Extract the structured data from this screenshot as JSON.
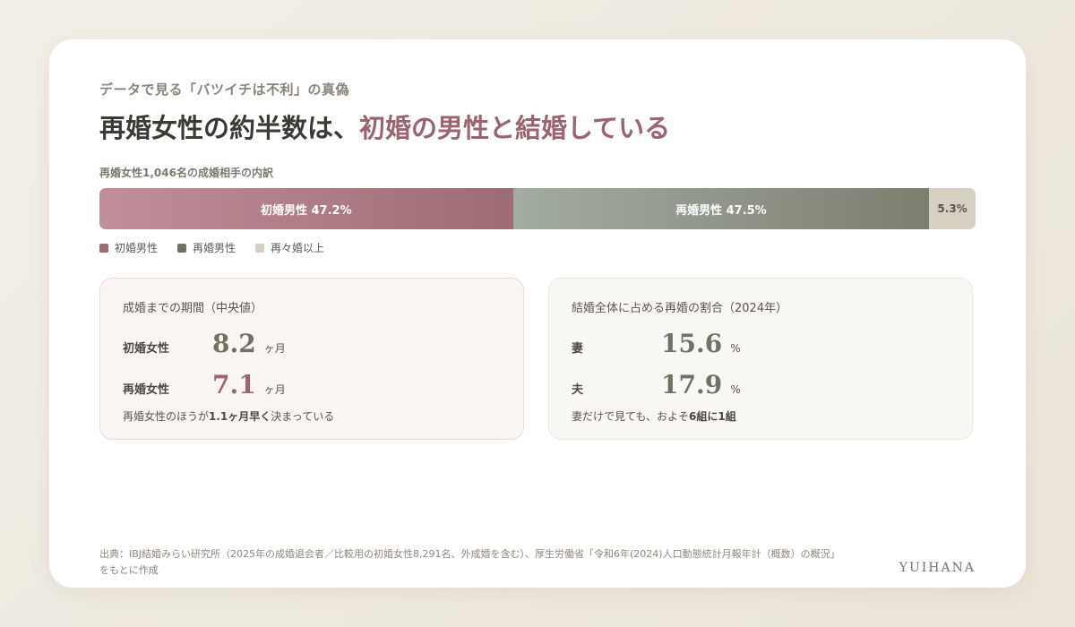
{
  "header": {
    "eyebrow": "データで見る「バツイチは不利」の真偽",
    "headline_main": "再婚女性の約半数は、",
    "headline_accent": "初婚の男性と結婚している"
  },
  "bar": {
    "caption": "再婚女性1,046名の成婚相手の内訳",
    "segments": [
      {
        "label": "初婚男性 47.2%",
        "value": 47.2,
        "color": "#9d6b74"
      },
      {
        "label": "再婚男性 47.5%",
        "value": 47.5,
        "color": "#7c7f70"
      },
      {
        "label": "5.3%",
        "value": 5.3,
        "color": "#d6d0c3"
      }
    ],
    "legend": [
      {
        "label": "初婚男性",
        "color": "#9d6b74"
      },
      {
        "label": "再婚男性",
        "color": "#6f7262"
      },
      {
        "label": "再々婚以上",
        "color": "#d6d0c3"
      }
    ]
  },
  "left_box": {
    "title": "成婚までの期間（中央値）",
    "rows": [
      {
        "label": "初婚女性",
        "value": "8.2",
        "unit": "ヶ月"
      },
      {
        "label": "再婚女性",
        "value": "7.1",
        "unit": "ヶ月"
      }
    ],
    "note_pre": "再婚女性のほうが",
    "note_bold": "1.1ヶ月早く",
    "note_post": "決まっている"
  },
  "right_box": {
    "title": "結婚全体に占める再婚の割合（2024年）",
    "rows": [
      {
        "label": "妻",
        "value": "15.6",
        "unit": "%"
      },
      {
        "label": "夫",
        "value": "17.9",
        "unit": "%"
      }
    ],
    "note_pre": "妻だけで見ても、およそ",
    "note_bold": "6組に1組",
    "note_post": ""
  },
  "footer": {
    "source_line1": "出典：IBJ結婚みらい研究所（2025年の成婚退会者／比較用の初婚女性8,291名、外成婚を含む）、厚生労働省「令和6年(2024)人口動態統計月報年計（概数）の概況」",
    "source_line2": "をもとに作成",
    "brand": "YUIHANA"
  }
}
